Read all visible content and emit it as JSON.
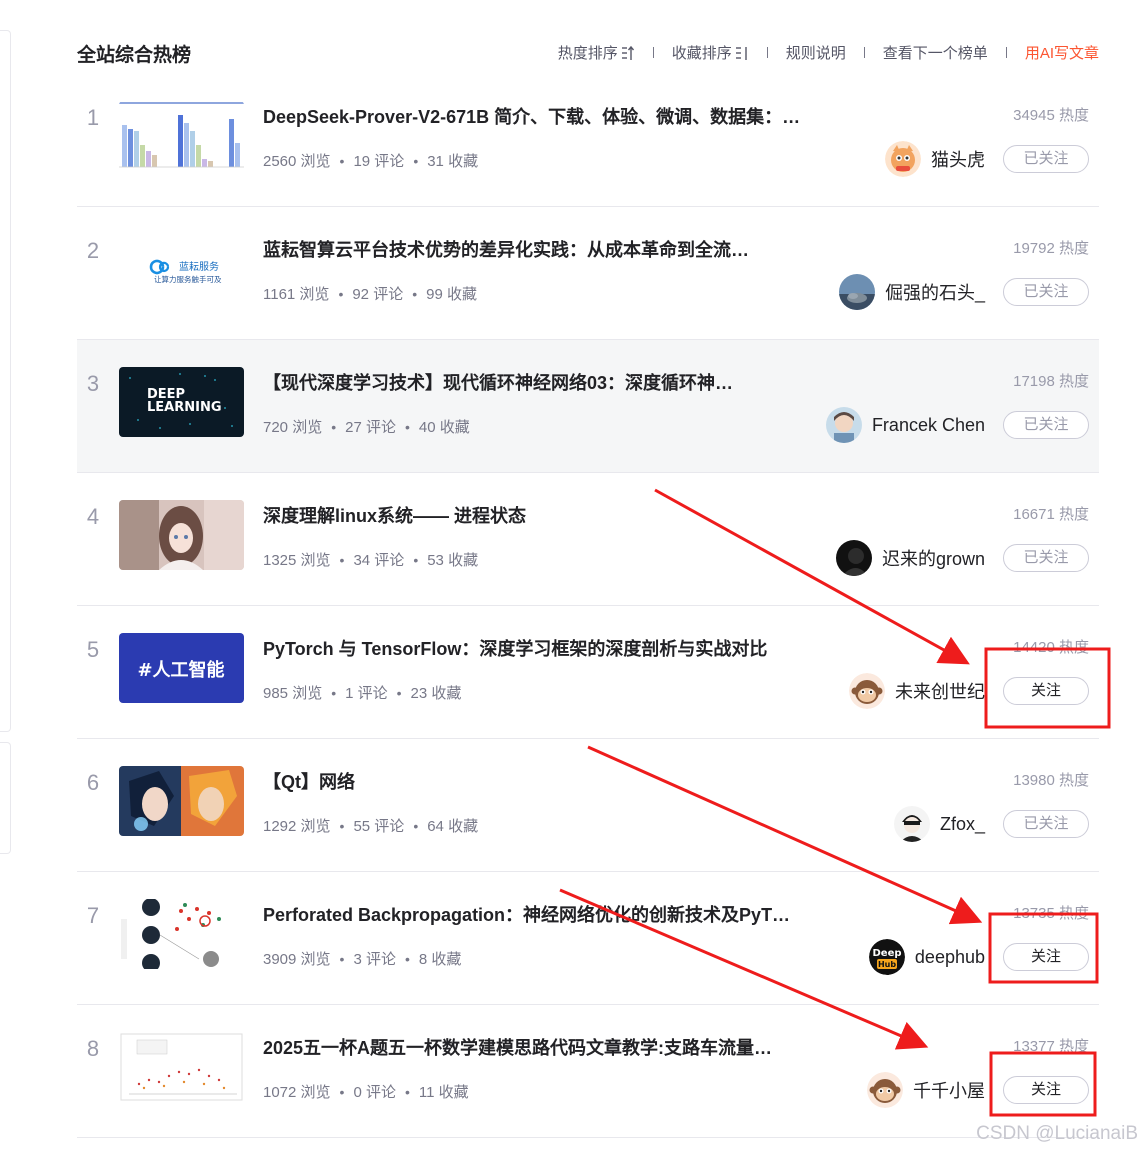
{
  "header": {
    "title": "全站综合热榜",
    "nav": {
      "heat_sort": "热度排序",
      "fav_sort": "收藏排序",
      "rules": "规则说明",
      "next_board": "查看下一个榜单",
      "ai_write": "用AI写文章"
    }
  },
  "articles": [
    {
      "rank": "1",
      "title": "DeepSeek-Prover-V2-671B 简介、下载、体验、微调、数据集：…",
      "views": "2560 浏览",
      "comments": "19 评论",
      "favorites": "31 收藏",
      "heat": "34945 热度",
      "author": "猫头虎",
      "follow": "已关注",
      "thumb": "bar-chart"
    },
    {
      "rank": "2",
      "title": "蓝耘智算云平台技术优势的差异化实践：从成本革命到全流…",
      "views": "1161 浏览",
      "comments": "92 评论",
      "favorites": "99 收藏",
      "heat": "19792 热度",
      "author": "倔强的石头_",
      "follow": "已关注",
      "thumb": "lanyun-logo",
      "thumb_text_1": "蓝耘服务",
      "thumb_text_2": "让算力服务触手可及"
    },
    {
      "rank": "3",
      "title": "【现代深度学习技术】现代循环神经网络03：深度循环神…",
      "views": "720 浏览",
      "comments": "27 评论",
      "favorites": "40 收藏",
      "heat": "17198 热度",
      "author": "Francek Chen",
      "follow": "已关注",
      "thumb": "deep-learning",
      "thumb_text_1": "DEEP",
      "thumb_text_2": "LEARNING"
    },
    {
      "rank": "4",
      "title": "深度理解linux系统—— 进程状态",
      "views": "1325 浏览",
      "comments": "34 评论",
      "favorites": "53 收藏",
      "heat": "16671 热度",
      "author": "迟来的grown",
      "follow": "已关注",
      "thumb": "anime-girl"
    },
    {
      "rank": "5",
      "title": "PyTorch 与 TensorFlow：深度学习框架的深度剖析与实战对比",
      "views": "985 浏览",
      "comments": "1 评论",
      "favorites": "23 收藏",
      "heat": "14420 热度",
      "author": "未来创世纪",
      "follow": "关注",
      "thumb": "ai-tag",
      "thumb_text_1": "#人工智能"
    },
    {
      "rank": "6",
      "title": "【Qt】网络",
      "views": "1292 浏览",
      "comments": "55 评论",
      "favorites": "64 收藏",
      "heat": "13980 热度",
      "author": "Zfox_",
      "follow": "已关注",
      "thumb": "anime-duo"
    },
    {
      "rank": "7",
      "title": "Perforated Backpropagation：神经网络优化的创新技术及PyT…",
      "views": "3909 浏览",
      "comments": "3 评论",
      "favorites": "8 收藏",
      "heat": "13735 热度",
      "author": "deephub",
      "follow": "关注",
      "thumb": "diagram",
      "avatar_text_1": "Deep",
      "avatar_text_2": "Hub"
    },
    {
      "rank": "8",
      "title": "2025五一杯A题五一杯数学建模思路代码文章教学:支路车流量…",
      "views": "1072 浏览",
      "comments": "0 评论",
      "favorites": "11 收藏",
      "heat": "13377 热度",
      "author": "千千小屋",
      "follow": "关注",
      "thumb": "scatter-plot"
    }
  ],
  "watermark": "CSDN @LucianaiB",
  "colors": {
    "accent": "#fc5531",
    "annotation_red": "#ee1c1c",
    "muted": "#999aaa",
    "highlight_row": "#f5f6f7"
  },
  "annotations": [
    "red-arrow",
    "red-highlight-box"
  ]
}
